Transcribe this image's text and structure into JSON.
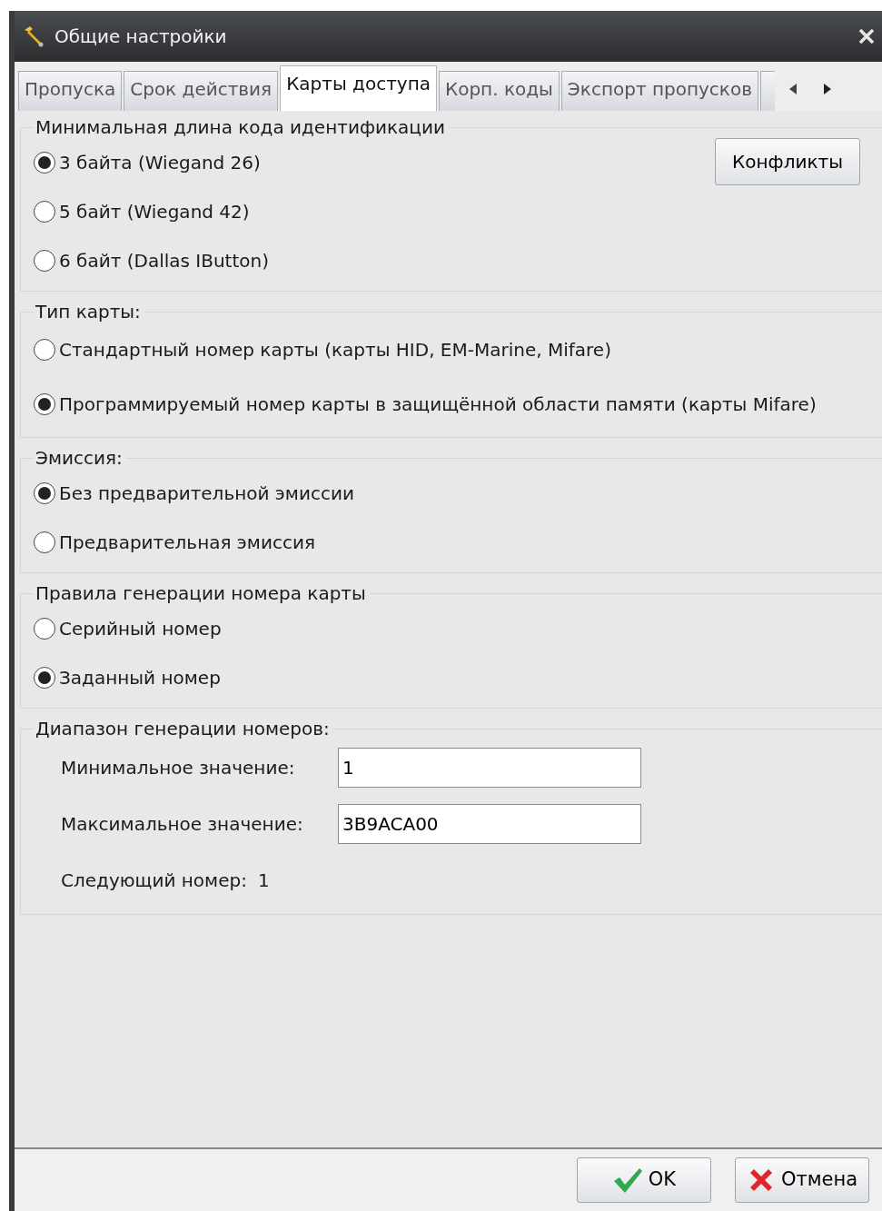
{
  "window": {
    "title": "Общие настройки"
  },
  "tabs": [
    {
      "label": "Пропуска",
      "selected": false
    },
    {
      "label": "Срок действия",
      "selected": false
    },
    {
      "label": "Карты доступа",
      "selected": true
    },
    {
      "label": "Корп. коды",
      "selected": false
    },
    {
      "label": "Экспорт пропусков",
      "selected": false
    }
  ],
  "groups": [
    {
      "kind": "radio",
      "title": "Минимальная длина кода идентификации",
      "button": "Конфликты",
      "options": [
        {
          "label": "3 байта (Wiegand 26)",
          "selected": true
        },
        {
          "label": "5 байт (Wiegand 42)",
          "selected": false
        },
        {
          "label": "6 байт (Dallas IButton)",
          "selected": false
        }
      ]
    },
    {
      "kind": "radio",
      "title": "Тип карты:",
      "options": [
        {
          "label": "Стандартный номер карты (карты HID, EM-Marine, Mifare)",
          "selected": false
        },
        {
          "label": "Программируемый номер карты в защищённой области памяти (карты Mifare)",
          "selected": true
        }
      ]
    },
    {
      "kind": "radio",
      "title": "Эмиссия:",
      "options": [
        {
          "label": "Без предварительной эмиссии",
          "selected": true
        },
        {
          "label": "Предварительная эмиссия",
          "selected": false
        }
      ]
    },
    {
      "kind": "radio",
      "title": "Правила генерации номера карты",
      "options": [
        {
          "label": "Серийный номер",
          "selected": false
        },
        {
          "label": "Заданный номер",
          "selected": true
        }
      ]
    },
    {
      "kind": "range",
      "title": "Диапазон генерации номеров:",
      "fields": [
        {
          "label": "Минимальное значение:",
          "value": "1"
        },
        {
          "label": "Максимальное значение:",
          "value": "3B9ACA00"
        }
      ],
      "next": {
        "label": "Следующий номер:",
        "value": "1"
      }
    }
  ],
  "buttons": [
    {
      "kind": "ok",
      "label": "OK"
    },
    {
      "kind": "cancel",
      "label": "Отмена"
    }
  ]
}
